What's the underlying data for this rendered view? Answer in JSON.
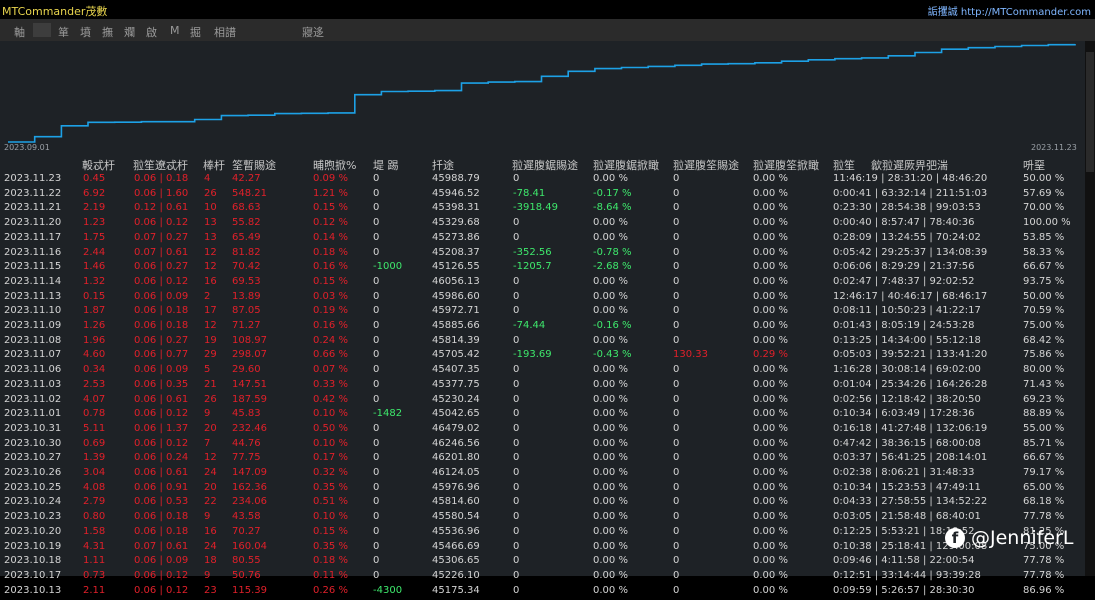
{
  "header": {
    "app_title": "MTCommander茂數",
    "site_link": "詬攫誠 http://MTCommander.com"
  },
  "menu": {
    "items": [
      "軸",
      "箪",
      "墳",
      "撫",
      "斕",
      "啟",
      "M",
      "掘",
      "相譜",
      "寢迻"
    ]
  },
  "chart_data": {
    "type": "area",
    "x_start_label": "2023.09.01",
    "x_end_label": "2023.11.23",
    "line_color": "#1da1e6",
    "values": [
      0,
      7.26,
      22.03,
      26.79,
      26.98,
      27.7,
      27.73,
      30.69,
      35.98,
      36.48,
      38.65,
      39.1,
      39.64,
      64.5,
      68.8,
      69.3,
      70.1,
      80.35,
      81.6,
      82.3,
      89.6,
      96.4,
      100,
      101.5,
      103,
      104.6,
      106.2,
      106.8,
      108,
      110.2,
      112,
      113.5,
      114.7,
      117.5,
      122,
      126.5,
      128.5,
      130.2,
      131.6,
      132.7,
      133.6
    ]
  },
  "table": {
    "headers": [
      "軗忒杅",
      "翋笙遼忒杅",
      "棒杅",
      "筌暫賜途",
      "晡煦掀%",
      "堤 踢",
      "扦途",
      "翋遲腹鋸賜途",
      "翋遲腹鋸掀瞰",
      "翋遲腹筌賜途",
      "翋遲腹筌掀瞰",
      "翋笙",
      "歙翋遲厥畀弝湍",
      "呏堊"
    ],
    "rows": [
      [
        "2023.11.23",
        "0.45",
        "0.06 | 0.18",
        "4",
        "42.27",
        "0.09 %",
        "0",
        "45988.79",
        "0",
        "0.00 %",
        "0",
        "0.00 %",
        "11:46:19 | 28:31:20 | 48:46:20",
        "50.00 %"
      ],
      [
        "2023.11.22",
        "6.92",
        "0.06 | 1.60",
        "26",
        "548.21",
        "1.21 %",
        "0",
        "45946.52",
        "-78.41",
        "-0.17 %",
        "0",
        "0.00 %",
        "0:00:41 | 63:32:14 | 211:51:03",
        "57.69 %"
      ],
      [
        "2023.11.21",
        "2.19",
        "0.12 | 0.61",
        "10",
        "68.63",
        "0.15 %",
        "0",
        "45398.31",
        "-3918.49",
        "-8.64 %",
        "0",
        "0.00 %",
        "0:23:30 | 28:54:38 | 99:03:53",
        "70.00 %"
      ],
      [
        "2023.11.20",
        "1.23",
        "0.06 | 0.12",
        "13",
        "55.82",
        "0.12 %",
        "0",
        "45329.68",
        "0",
        "0.00 %",
        "0",
        "0.00 %",
        "0:00:40 | 8:57:47 | 78:40:36",
        "100.00 %"
      ],
      [
        "2023.11.17",
        "1.75",
        "0.07 | 0.27",
        "13",
        "65.49",
        "0.14 %",
        "0",
        "45273.86",
        "0",
        "0.00 %",
        "0",
        "0.00 %",
        "0:28:09 | 13:24:55 | 70:24:02",
        "53.85 %"
      ],
      [
        "2023.11.16",
        "2.44",
        "0.07 | 0.61",
        "12",
        "81.82",
        "0.18 %",
        "0",
        "45208.37",
        "-352.56",
        "-0.78 %",
        "0",
        "0.00 %",
        "0:05:42 | 29:25:37 | 134:08:39",
        "58.33 %"
      ],
      [
        "2023.11.15",
        "1.46",
        "0.06 | 0.27",
        "12",
        "70.42",
        "0.16 %",
        "-1000",
        "45126.55",
        "-1205.7",
        "-2.68 %",
        "0",
        "0.00 %",
        "0:06:06 | 8:29:29 | 21:37:56",
        "66.67 %"
      ],
      [
        "2023.11.14",
        "1.32",
        "0.06 | 0.12",
        "16",
        "69.53",
        "0.15 %",
        "0",
        "46056.13",
        "0",
        "0.00 %",
        "0",
        "0.00 %",
        "0:02:47 | 7:48:37 | 92:02:52",
        "93.75 %"
      ],
      [
        "2023.11.13",
        "0.15",
        "0.06 | 0.09",
        "2",
        "13.89",
        "0.03 %",
        "0",
        "45986.60",
        "0",
        "0.00 %",
        "0",
        "0.00 %",
        "12:46:17 | 40:46:17 | 68:46:17",
        "50.00 %"
      ],
      [
        "2023.11.10",
        "1.87",
        "0.06 | 0.18",
        "17",
        "87.05",
        "0.19 %",
        "0",
        "45972.71",
        "0",
        "0.00 %",
        "0",
        "0.00 %",
        "0:08:11 | 10:50:23 | 41:22:17",
        "70.59 %"
      ],
      [
        "2023.11.09",
        "1.26",
        "0.06 | 0.18",
        "12",
        "71.27",
        "0.16 %",
        "0",
        "45885.66",
        "-74.44",
        "-0.16 %",
        "0",
        "0.00 %",
        "0:01:43 | 8:05:19 | 24:53:28",
        "75.00 %"
      ],
      [
        "2023.11.08",
        "1.96",
        "0.06 | 0.27",
        "19",
        "108.97",
        "0.24 %",
        "0",
        "45814.39",
        "0",
        "0.00 %",
        "0",
        "0.00 %",
        "0:13:25 | 14:34:00 | 55:12:18",
        "68.42 %"
      ],
      [
        "2023.11.07",
        "4.60",
        "0.06 | 0.77",
        "29",
        "298.07",
        "0.66 %",
        "0",
        "45705.42",
        "-193.69",
        "-0.43 %",
        "130.33",
        "0.29 %",
        "0:05:03 | 39:52:21 | 133:41:20",
        "75.86 %"
      ],
      [
        "2023.11.06",
        "0.34",
        "0.06 | 0.09",
        "5",
        "29.60",
        "0.07 %",
        "0",
        "45407.35",
        "0",
        "0.00 %",
        "0",
        "0.00 %",
        "1:16:28 | 30:08:14 | 69:02:00",
        "80.00 %"
      ],
      [
        "2023.11.03",
        "2.53",
        "0.06 | 0.35",
        "21",
        "147.51",
        "0.33 %",
        "0",
        "45377.75",
        "0",
        "0.00 %",
        "0",
        "0.00 %",
        "0:01:04 | 25:34:26 | 164:26:28",
        "71.43 %"
      ],
      [
        "2023.11.02",
        "4.07",
        "0.06 | 0.61",
        "26",
        "187.59",
        "0.42 %",
        "0",
        "45230.24",
        "0",
        "0.00 %",
        "0",
        "0.00 %",
        "0:02:56 | 12:18:42 | 38:20:50",
        "69.23 %"
      ],
      [
        "2023.11.01",
        "0.78",
        "0.06 | 0.12",
        "9",
        "45.83",
        "0.10 %",
        "-1482",
        "45042.65",
        "0",
        "0.00 %",
        "0",
        "0.00 %",
        "0:10:34 | 6:03:49 | 17:28:36",
        "88.89 %"
      ],
      [
        "2023.10.31",
        "5.11",
        "0.06 | 1.37",
        "20",
        "232.46",
        "0.50 %",
        "0",
        "46479.02",
        "0",
        "0.00 %",
        "0",
        "0.00 %",
        "0:16:18 | 41:27:48 | 132:06:19",
        "55.00 %"
      ],
      [
        "2023.10.30",
        "0.69",
        "0.06 | 0.12",
        "7",
        "44.76",
        "0.10 %",
        "0",
        "46246.56",
        "0",
        "0.00 %",
        "0",
        "0.00 %",
        "0:47:42 | 38:36:15 | 68:00:08",
        "85.71 %"
      ],
      [
        "2023.10.27",
        "1.39",
        "0.06 | 0.24",
        "12",
        "77.75",
        "0.17 %",
        "0",
        "46201.80",
        "0",
        "0.00 %",
        "0",
        "0.00 %",
        "0:03:37 | 56:41:25 | 208:14:01",
        "66.67 %"
      ],
      [
        "2023.10.26",
        "3.04",
        "0.06 | 0.61",
        "24",
        "147.09",
        "0.32 %",
        "0",
        "46124.05",
        "0",
        "0.00 %",
        "0",
        "0.00 %",
        "0:02:38 | 8:06:21 | 31:48:33",
        "79.17 %"
      ],
      [
        "2023.10.25",
        "4.08",
        "0.06 | 0.91",
        "20",
        "162.36",
        "0.35 %",
        "0",
        "45976.96",
        "0",
        "0.00 %",
        "0",
        "0.00 %",
        "0:10:34 | 15:23:53 | 47:49:11",
        "65.00 %"
      ],
      [
        "2023.10.24",
        "2.79",
        "0.06 | 0.53",
        "22",
        "234.06",
        "0.51 %",
        "0",
        "45814.60",
        "0",
        "0.00 %",
        "0",
        "0.00 %",
        "0:04:33 | 27:58:55 | 134:52:22",
        "68.18 %"
      ],
      [
        "2023.10.23",
        "0.80",
        "0.06 | 0.18",
        "9",
        "43.58",
        "0.10 %",
        "0",
        "45580.54",
        "0",
        "0.00 %",
        "0",
        "0.00 %",
        "0:03:05 | 21:58:48 | 68:40:01",
        "77.78 %"
      ],
      [
        "2023.10.20",
        "1.58",
        "0.06 | 0.18",
        "16",
        "70.27",
        "0.15 %",
        "0",
        "45536.96",
        "0",
        "0.00 %",
        "0",
        "0.00 %",
        "0:12:25 | 5:53:21 | 18:10:52",
        "81.25 %"
      ],
      [
        "2023.10.19",
        "4.31",
        "0.07 | 0.61",
        "24",
        "160.04",
        "0.35 %",
        "0",
        "45466.69",
        "0",
        "0.00 %",
        "0",
        "0.00 %",
        "0:10:38 | 25:18:41 | 129:00:08",
        "75.00 %"
      ],
      [
        "2023.10.18",
        "1.11",
        "0.06 | 0.09",
        "18",
        "80.55",
        "0.18 %",
        "0",
        "45306.65",
        "0",
        "0.00 %",
        "0",
        "0.00 %",
        "0:09:46 | 4:11:58 | 22:00:54",
        "77.78 %"
      ],
      [
        "2023.10.17",
        "0.73",
        "0.06 | 0.12",
        "9",
        "50.76",
        "0.11 %",
        "0",
        "45226.10",
        "0",
        "0.00 %",
        "0",
        "0.00 %",
        "0:12:51 | 33:14:44 | 93:39:28",
        "77.78 %"
      ],
      [
        "2023.10.13",
        "2.11",
        "0.06 | 0.12",
        "23",
        "115.39",
        "0.26 %",
        "-4300",
        "45175.34",
        "0",
        "0.00 %",
        "0",
        "0.00 %",
        "0:09:59 | 5:26:57 | 28:30:30",
        "86.96 %"
      ]
    ]
  },
  "watermark": {
    "icon": "facebook-icon",
    "text": "@JenniferL"
  },
  "colors": {
    "negative": "#e0202a",
    "positive": "#3ee86c",
    "panel_bg": "#1e2226"
  }
}
